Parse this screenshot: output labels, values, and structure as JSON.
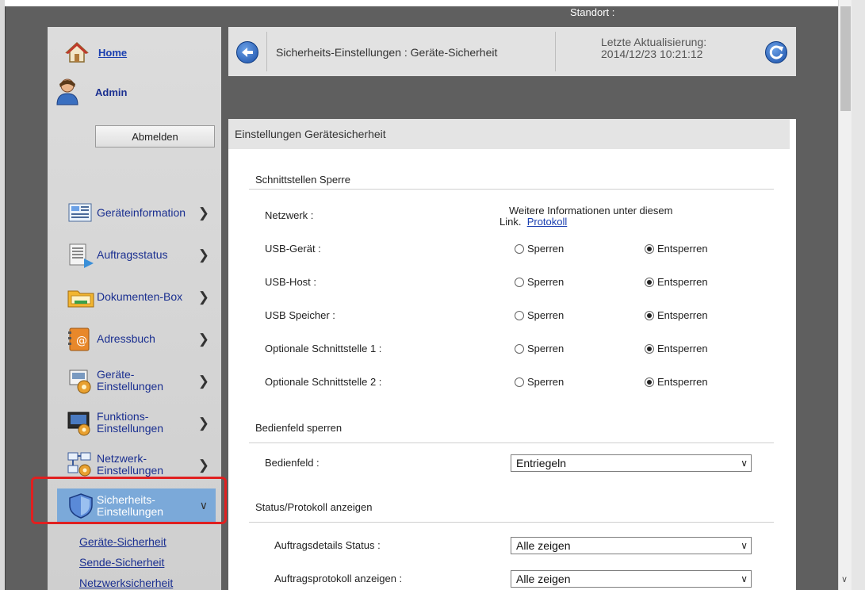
{
  "header": {
    "location_label": "Standort :"
  },
  "sidebar": {
    "home_label": "Home",
    "user_label": "Admin",
    "logout_label": "Abmelden",
    "items": [
      {
        "label": "Geräteinformation",
        "icon": "device-info-icon"
      },
      {
        "label": "Auftragsstatus",
        "icon": "job-status-icon"
      },
      {
        "label": "Dokumenten-Box",
        "icon": "document-box-icon"
      },
      {
        "label": "Adressbuch",
        "icon": "address-book-icon"
      },
      {
        "label": "Geräte-Einstellungen",
        "icon": "device-settings-icon"
      },
      {
        "label": "Funktions-Einstellungen",
        "icon": "function-settings-icon"
      },
      {
        "label": "Netzwerk-Einstellungen",
        "icon": "network-settings-icon"
      },
      {
        "label": "Sicherheits-Einstellungen",
        "icon": "shield-icon",
        "active": true
      }
    ],
    "sublinks": [
      "Geräte-Sicherheit",
      "Sende-Sicherheit",
      "Netzwerksicherheit"
    ]
  },
  "breadcrumb": {
    "title": "Sicherheits-Einstellungen : Geräte-Sicherheit",
    "updated_label": "Letzte Aktualisierung:",
    "updated_value": "2014/12/23 10:21:12"
  },
  "panel": {
    "title": "Einstellungen Gerätesicherheit",
    "interface_lock": {
      "section_title": "Schnittstellen Sperre",
      "network_label": "Netzwerk :",
      "network_info": "Weitere Informationen unter diesem",
      "network_info2": "Link.",
      "network_link": "Protokoll",
      "option_lock": "Sperren",
      "option_unlock": "Entsperren",
      "rows": [
        {
          "label": "USB-Gerät :",
          "selected": "Entsperren"
        },
        {
          "label": "USB-Host :",
          "selected": "Entsperren"
        },
        {
          "label": "USB Speicher :",
          "selected": "Entsperren"
        },
        {
          "label": "Optionale Schnittstelle 1 :",
          "selected": "Entsperren"
        },
        {
          "label": "Optionale Schnittstelle 2 :",
          "selected": "Entsperren"
        }
      ]
    },
    "panel_lock": {
      "section_title": "Bedienfeld sperren",
      "label": "Bedienfeld :",
      "value": "Entriegeln"
    },
    "status_log": {
      "section_title": "Status/Protokoll anzeigen",
      "rows": [
        {
          "label": "Auftragsdetails Status :",
          "value": "Alle zeigen"
        },
        {
          "label": "Auftragsprotokoll anzeigen :",
          "value": "Alle zeigen"
        }
      ]
    }
  },
  "colors": {
    "active_nav": "#7ba9d9",
    "link": "#1a3fb0",
    "highlight": "#e02020"
  }
}
